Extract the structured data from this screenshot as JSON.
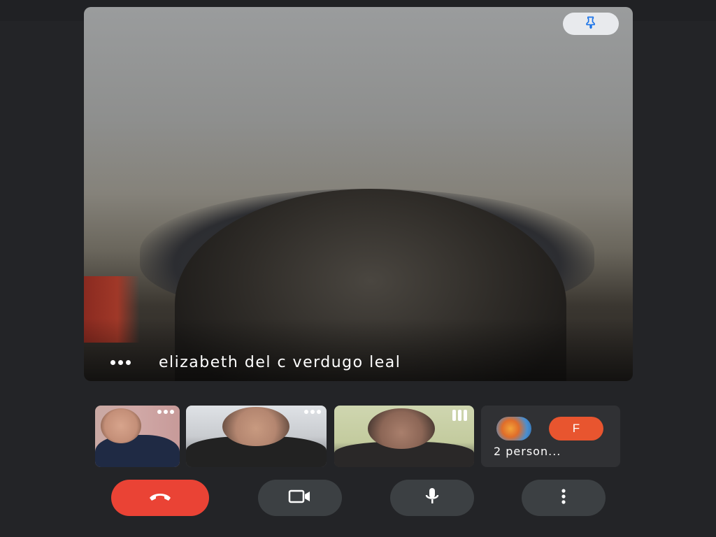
{
  "main_video": {
    "participant_name": "elizabeth del c verdugo leal",
    "pin_icon": "pin-icon",
    "more_icon": "more-horiz-icon"
  },
  "thumbnails": [
    {
      "kind": "video",
      "indicator": "more-horiz-icon"
    },
    {
      "kind": "video",
      "indicator": "more-horiz-icon"
    },
    {
      "kind": "video",
      "indicator": "speaking-bars-icon"
    },
    {
      "kind": "group",
      "avatar_initial": "F",
      "label": "2 person..."
    }
  ],
  "controls": {
    "end_call_icon": "call-end-icon",
    "camera_icon": "videocam-icon",
    "mic_icon": "mic-icon",
    "more_icon": "more-vert-icon"
  },
  "colors": {
    "background": "#232427",
    "end_call": "#ea4335",
    "control_bg": "#3c4043",
    "avatar_f": "#e8552f",
    "pin_bg": "#e8eaed",
    "pin_icon": "#1a73e8"
  }
}
